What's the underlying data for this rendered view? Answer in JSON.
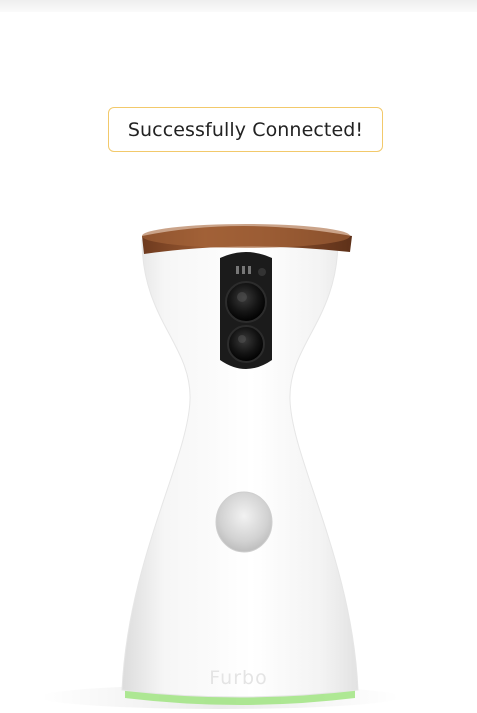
{
  "toast": {
    "message": "Successfully Connected!",
    "border_color": "#f2c96b"
  },
  "device": {
    "brand_label": "Furbo",
    "body_color": "#f4f4f4",
    "lid_color": "#8a4f2c",
    "camera_color": "#1b1b1b",
    "base_light_color": "#9be37a"
  }
}
